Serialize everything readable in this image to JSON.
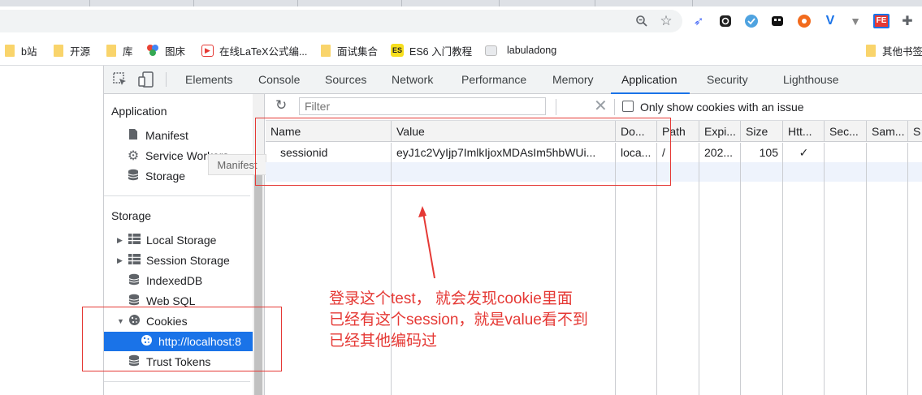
{
  "bookmarks": [
    {
      "label": "b站",
      "icon": "folder-icon"
    },
    {
      "label": "开源",
      "icon": "folder-icon"
    },
    {
      "label": "库",
      "icon": "folder-icon"
    },
    {
      "label": "图床",
      "icon": "colorful-dots-icon"
    },
    {
      "label": "在线LaTeX公式编...",
      "icon": "latex-editor-icon"
    },
    {
      "label": "面试集合",
      "icon": "folder-icon"
    },
    {
      "label": "ES6 入门教程",
      "icon": "es-badge-icon"
    },
    {
      "label": "labuladong",
      "icon": "page-icon"
    },
    {
      "label": "其他书签",
      "icon": "folder-icon"
    }
  ],
  "es_badge": "ES",
  "fe_badge": "FE",
  "devtools": {
    "tabs": [
      "Elements",
      "Console",
      "Sources",
      "Network",
      "Performance",
      "Memory",
      "Application",
      "Security",
      "Lighthouse"
    ],
    "active_tab": "Application"
  },
  "sidebar": {
    "application_heading": "Application",
    "application_items": [
      {
        "label": "Manifest",
        "icon": "file-icon"
      },
      {
        "label": "Service Workers",
        "icon": "gear-icon"
      },
      {
        "label": "Storage",
        "icon": "database-icon"
      }
    ],
    "storage_heading": "Storage",
    "storage_items": [
      {
        "label": "Local Storage",
        "icon": "grid-icon"
      },
      {
        "label": "Session Storage",
        "icon": "grid-icon"
      },
      {
        "label": "IndexedDB",
        "icon": "database-icon"
      },
      {
        "label": "Web SQL",
        "icon": "database-icon"
      },
      {
        "label": "Cookies",
        "icon": "cookie-icon"
      },
      {
        "label": "http://localhost:8",
        "icon": "cookie-icon"
      },
      {
        "label": "Trust Tokens",
        "icon": "database-icon"
      }
    ],
    "tooltip": "Manifest"
  },
  "cookie_toolbar": {
    "filter_placeholder": "Filter",
    "only_issue_label": "Only show cookies with an issue"
  },
  "cookie_table": {
    "headers": [
      "Name",
      "Value",
      "Do...",
      "Path",
      "Expi...",
      "Size",
      "Htt...",
      "Sec...",
      "Sam...",
      "S"
    ],
    "rows": [
      [
        "sessionid",
        "eyJ1c2VyIjp7ImlkIjoxMDAsIm5hbWUi...",
        "loca...",
        "/",
        "202...",
        "105",
        "✓",
        "",
        "",
        ""
      ]
    ]
  },
  "annotation": "登录这个test， 就会发现cookie里面\n已经有这个session，就是value看不到\n已经其他编码过",
  "colors": {
    "accent": "#1a73e8",
    "annotation_red": "#e53935"
  }
}
